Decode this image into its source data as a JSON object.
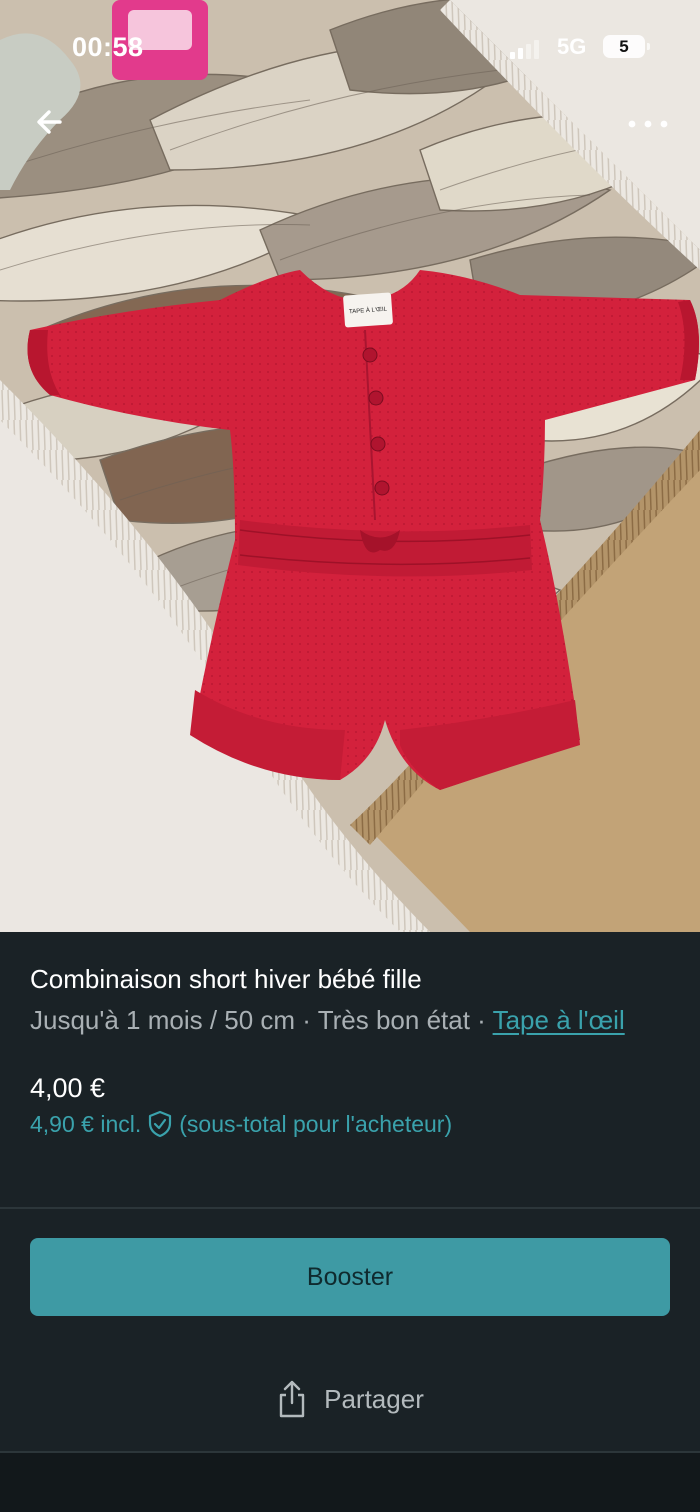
{
  "status_bar": {
    "time": "00:58",
    "network": "5G",
    "battery": "5"
  },
  "navigation": {
    "back_icon": "arrow-left-icon",
    "more_icon": "more-horizontal-icon"
  },
  "photo": {
    "subject": "product-photo",
    "label_text": "TAPE À L'ŒIL"
  },
  "item": {
    "title": "Combinaison short hiver bébé fille",
    "size_condition": "Jusqu'à 1 mois / 50 cm · Très bon état · ",
    "brand": "Tape à l'œil",
    "price": "4,00 €",
    "price_incl": "4,90 € incl.",
    "buyer_note": "(sous-total pour l'acheteur)",
    "protection_icon": "shield-check-icon"
  },
  "actions": {
    "boost_label": "Booster",
    "share_label": "Partager",
    "share_icon": "share-icon"
  },
  "colors": {
    "background": "#1a2226",
    "accent": "#3e9aa4",
    "link": "#3aa2ac",
    "garment": "#d0203a"
  }
}
